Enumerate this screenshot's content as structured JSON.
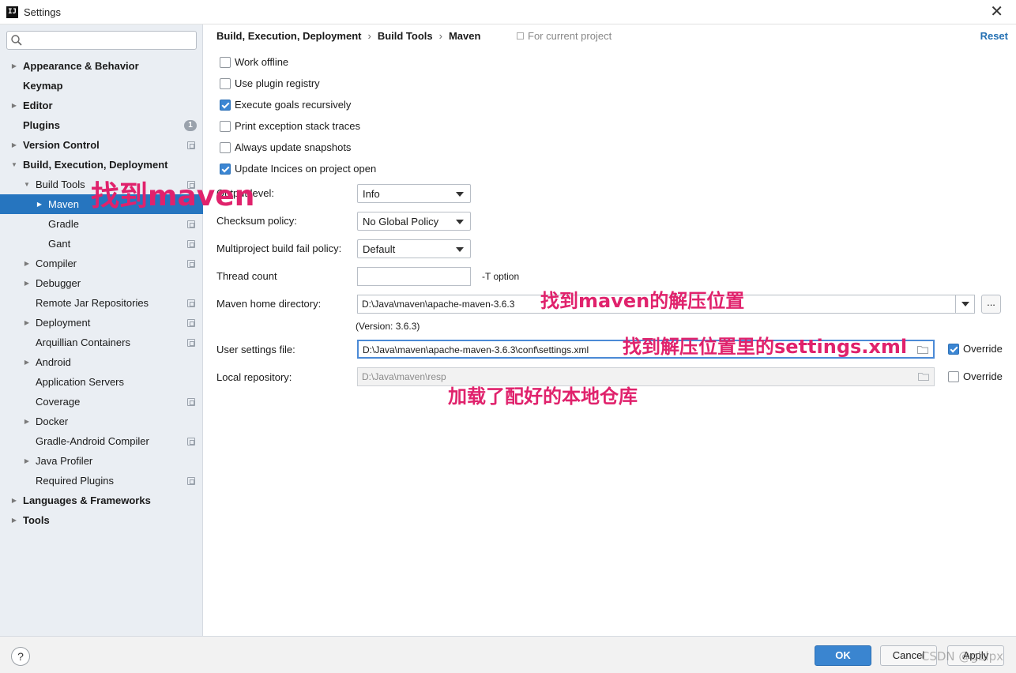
{
  "window": {
    "title": "Settings",
    "app_icon": "IJ"
  },
  "sidebar": {
    "search": {
      "placeholder": "",
      "value": ""
    },
    "items": [
      {
        "label": "Appearance & Behavior",
        "bold": true,
        "arrow": "right",
        "indent": 0
      },
      {
        "label": "Keymap",
        "bold": true,
        "arrow": "none",
        "indent": 0
      },
      {
        "label": "Editor",
        "bold": true,
        "arrow": "right",
        "indent": 0
      },
      {
        "label": "Plugins",
        "bold": true,
        "arrow": "none",
        "indent": 0,
        "badge": "1"
      },
      {
        "label": "Version Control",
        "bold": true,
        "arrow": "right",
        "indent": 0,
        "project": true
      },
      {
        "label": "Build, Execution, Deployment",
        "bold": true,
        "arrow": "down",
        "indent": 0
      },
      {
        "label": "Build Tools",
        "bold": false,
        "arrow": "down",
        "indent": 1,
        "project": true
      },
      {
        "label": "Maven",
        "bold": false,
        "arrow": "right",
        "indent": 2,
        "selected": true,
        "project": true
      },
      {
        "label": "Gradle",
        "bold": false,
        "arrow": "none",
        "indent": 2,
        "project": true
      },
      {
        "label": "Gant",
        "bold": false,
        "arrow": "none",
        "indent": 2,
        "project": true
      },
      {
        "label": "Compiler",
        "bold": false,
        "arrow": "right",
        "indent": 1,
        "project": true
      },
      {
        "label": "Debugger",
        "bold": false,
        "arrow": "right",
        "indent": 1
      },
      {
        "label": "Remote Jar Repositories",
        "bold": false,
        "arrow": "none",
        "indent": 1,
        "project": true
      },
      {
        "label": "Deployment",
        "bold": false,
        "arrow": "right",
        "indent": 1,
        "project": true
      },
      {
        "label": "Arquillian Containers",
        "bold": false,
        "arrow": "none",
        "indent": 1,
        "project": true
      },
      {
        "label": "Android",
        "bold": false,
        "arrow": "right",
        "indent": 1
      },
      {
        "label": "Application Servers",
        "bold": false,
        "arrow": "none",
        "indent": 1
      },
      {
        "label": "Coverage",
        "bold": false,
        "arrow": "none",
        "indent": 1,
        "project": true
      },
      {
        "label": "Docker",
        "bold": false,
        "arrow": "right",
        "indent": 1
      },
      {
        "label": "Gradle-Android Compiler",
        "bold": false,
        "arrow": "none",
        "indent": 1,
        "project": true
      },
      {
        "label": "Java Profiler",
        "bold": false,
        "arrow": "right",
        "indent": 1
      },
      {
        "label": "Required Plugins",
        "bold": false,
        "arrow": "none",
        "indent": 1,
        "project": true
      },
      {
        "label": "Languages & Frameworks",
        "bold": true,
        "arrow": "right",
        "indent": 0
      },
      {
        "label": "Tools",
        "bold": true,
        "arrow": "right",
        "indent": 0
      }
    ]
  },
  "header": {
    "breadcrumb": [
      "Build, Execution, Deployment",
      "Build Tools",
      "Maven"
    ],
    "separator": "›",
    "for_current_project": "For current project",
    "reset": "Reset"
  },
  "checkboxes": [
    {
      "label": "Work offline",
      "checked": false
    },
    {
      "label": "Use plugin registry",
      "checked": false
    },
    {
      "label": "Execute goals recursively",
      "checked": true
    },
    {
      "label": "Print exception stack traces",
      "checked": false
    },
    {
      "label": "Always update snapshots",
      "checked": false
    },
    {
      "label": "Update Incices on project open",
      "checked": true
    }
  ],
  "form": {
    "output_level": {
      "label": "Output level:",
      "value": "Info"
    },
    "checksum_policy": {
      "label": "Checksum policy:",
      "value": "No Global Policy"
    },
    "multiproject_fail_policy": {
      "label": "Multiproject build fail policy:",
      "value": "Default"
    },
    "thread_count": {
      "label": "Thread count",
      "value": "",
      "hint": "-T option"
    },
    "maven_home": {
      "label": "Maven home directory:",
      "value": "D:\\Java\\maven\\apache-maven-3.6.3",
      "browse": "...",
      "version": "(Version: 3.6.3)"
    },
    "user_settings": {
      "label": "User settings file:",
      "value": "D:\\Java\\maven\\apache-maven-3.6.3\\conf\\settings.xml",
      "override_label": "Override",
      "override": true
    },
    "local_repo": {
      "label": "Local repository:",
      "value": "D:\\Java\\maven\\resp",
      "override_label": "Override",
      "override": false
    }
  },
  "annotations": {
    "find_maven": "找到maven",
    "find_unzip": "找到maven的解压位置",
    "find_settings": "找到解压位置里的settings.xml",
    "loaded_repo": "加载了配好的本地仓库"
  },
  "footer": {
    "help": "?",
    "ok": "OK",
    "cancel": "Cancel",
    "apply": "Apply",
    "watermark": "CSDN @gblpx"
  },
  "colors": {
    "accent": "#2675bf",
    "annotation": "#e0226c",
    "link": "#2470b3"
  }
}
